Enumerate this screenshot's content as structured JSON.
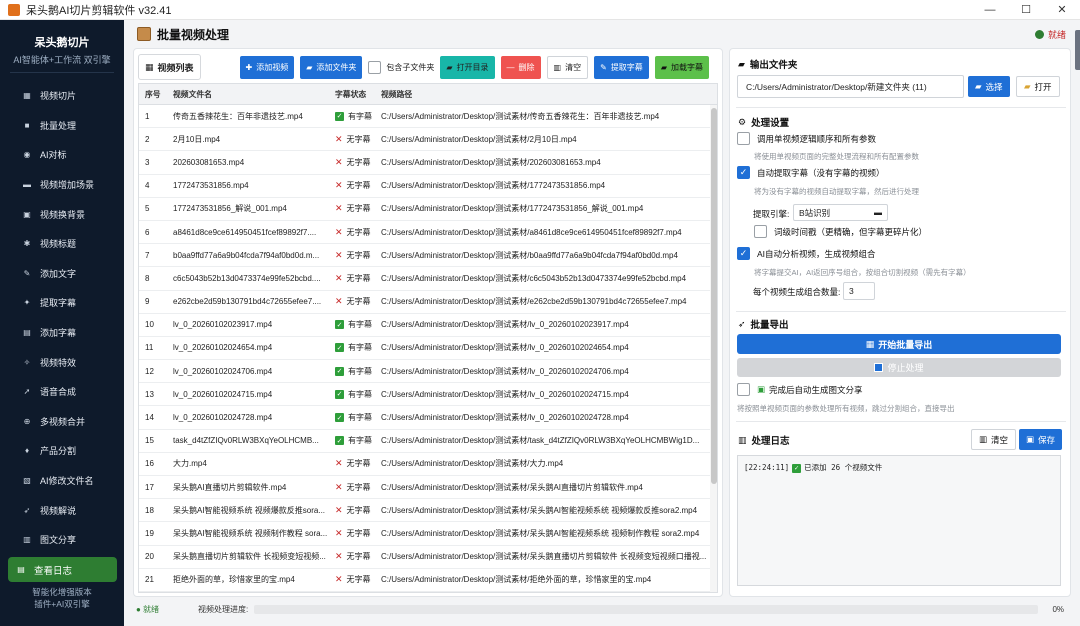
{
  "window": {
    "title": "呆头鹅AI切片剪辑软件 v32.41",
    "minimize": "—",
    "maximize": "☐",
    "close": "✕"
  },
  "sidebar": {
    "brand_name": "呆头鹅切片",
    "brand_sub": "AI智能体+工作流 双引擎",
    "items": [
      {
        "icon": "clip-icon",
        "glyph": "▦",
        "label": "视频切片"
      },
      {
        "icon": "batch-icon",
        "glyph": "■",
        "label": "批量处理"
      },
      {
        "icon": "ai-icon",
        "glyph": "◉",
        "label": "AI对标"
      },
      {
        "icon": "scene-icon",
        "glyph": "▬",
        "label": "视频增加场景"
      },
      {
        "icon": "background-icon",
        "glyph": "▣",
        "label": "视频换背景"
      },
      {
        "icon": "title-icon",
        "glyph": "✱",
        "label": "视频标题"
      },
      {
        "icon": "text-icon",
        "glyph": "✎",
        "label": "添加文字"
      },
      {
        "icon": "extract-icon",
        "glyph": "✦",
        "label": "提取字幕"
      },
      {
        "icon": "subtitle-icon",
        "glyph": "▤",
        "label": "添加字幕"
      },
      {
        "icon": "effects-icon",
        "glyph": "✧",
        "label": "视频特效"
      },
      {
        "icon": "voice-icon",
        "glyph": "➚",
        "label": "语音合成"
      },
      {
        "icon": "merge-icon",
        "glyph": "⊕",
        "label": "多视频合并"
      },
      {
        "icon": "product-icon",
        "glyph": "♦",
        "label": "产品分割"
      },
      {
        "icon": "rename-icon",
        "glyph": "▧",
        "label": "AI修改文件名"
      },
      {
        "icon": "analyze-icon",
        "glyph": "➶",
        "label": "视频解说"
      },
      {
        "icon": "share-icon",
        "glyph": "▥",
        "label": "图文分享"
      }
    ],
    "log_button": "查看日志",
    "footer_line1": "智能化增强版本",
    "footer_line2": "插件+AI双引擎"
  },
  "header": {
    "title": "批量视频处理",
    "status": "就绪"
  },
  "toolbar": {
    "video_list_tab": "视频列表",
    "add_video": "添加视频",
    "add_folder": "添加文件夹",
    "include_subfolders": "包含子文件夹",
    "open_dir": "打开目录",
    "delete": "删除",
    "clear": "清空",
    "extract_subtitles": "提取字幕",
    "add_subtitles": "加载字幕"
  },
  "table": {
    "headers": [
      "序号",
      "视频文件名",
      "字幕状态",
      "视频路径"
    ],
    "rows": [
      {
        "no": "1",
        "name": "传奇五香辣花生：百年非遗技艺.mp4",
        "ok": true,
        "status": "有字幕",
        "path": "C:/Users/Administrator/Desktop/测试素材/传奇五香辣花生：百年非遗技艺.mp4"
      },
      {
        "no": "2",
        "name": "2月10日.mp4",
        "ok": false,
        "status": "无字幕",
        "path": "C:/Users/Administrator/Desktop/测试素材/2月10日.mp4"
      },
      {
        "no": "3",
        "name": "202603081653.mp4",
        "ok": false,
        "status": "无字幕",
        "path": "C:/Users/Administrator/Desktop/测试素材/202603081653.mp4"
      },
      {
        "no": "4",
        "name": "1772473531856.mp4",
        "ok": false,
        "status": "无字幕",
        "path": "C:/Users/Administrator/Desktop/测试素材/1772473531856.mp4"
      },
      {
        "no": "5",
        "name": "1772473531856_解说_001.mp4",
        "ok": false,
        "status": "无字幕",
        "path": "C:/Users/Administrator/Desktop/测试素材/1772473531856_解说_001.mp4"
      },
      {
        "no": "6",
        "name": "a8461d8ce9ce614950451fcef89892f7....",
        "ok": false,
        "status": "无字幕",
        "path": "C:/Users/Administrator/Desktop/测试素材/a8461d8ce9ce614950451fcef89892f7.mp4"
      },
      {
        "no": "7",
        "name": "b0aa9ffd77a6a9b04fcda7f94af0bd0d.m...",
        "ok": false,
        "status": "无字幕",
        "path": "C:/Users/Administrator/Desktop/测试素材/b0aa9ffd77a6a9b04fcda7f94af0bd0d.mp4"
      },
      {
        "no": "8",
        "name": "c6c5043b52b13d0473374e99fe52bcbd....",
        "ok": false,
        "status": "无字幕",
        "path": "C:/Users/Administrator/Desktop/测试素材/c6c5043b52b13d0473374e99fe52bcbd.mp4"
      },
      {
        "no": "9",
        "name": "e262cbe2d59b130791bd4c72655efee7....",
        "ok": false,
        "status": "无字幕",
        "path": "C:/Users/Administrator/Desktop/测试素材/e262cbe2d59b130791bd4c72655efee7.mp4"
      },
      {
        "no": "10",
        "name": "lv_0_20260102023917.mp4",
        "ok": true,
        "status": "有字幕",
        "path": "C:/Users/Administrator/Desktop/测试素材/lv_0_20260102023917.mp4"
      },
      {
        "no": "11",
        "name": "lv_0_20260102024654.mp4",
        "ok": true,
        "status": "有字幕",
        "path": "C:/Users/Administrator/Desktop/测试素材/lv_0_20260102024654.mp4"
      },
      {
        "no": "12",
        "name": "lv_0_20260102024706.mp4",
        "ok": true,
        "status": "有字幕",
        "path": "C:/Users/Administrator/Desktop/测试素材/lv_0_20260102024706.mp4"
      },
      {
        "no": "13",
        "name": "lv_0_20260102024715.mp4",
        "ok": true,
        "status": "有字幕",
        "path": "C:/Users/Administrator/Desktop/测试素材/lv_0_20260102024715.mp4"
      },
      {
        "no": "14",
        "name": "lv_0_20260102024728.mp4",
        "ok": true,
        "status": "有字幕",
        "path": "C:/Users/Administrator/Desktop/测试素材/lv_0_20260102024728.mp4"
      },
      {
        "no": "15",
        "name": "task_d4tZfZIQv0RLW3BXqYeOLHCMB...",
        "ok": true,
        "status": "有字幕",
        "path": "C:/Users/Administrator/Desktop/测试素材/task_d4tZfZIQv0RLW3BXqYeOLHCMBWig1D..."
      },
      {
        "no": "16",
        "name": "大力.mp4",
        "ok": false,
        "status": "无字幕",
        "path": "C:/Users/Administrator/Desktop/测试素材/大力.mp4"
      },
      {
        "no": "17",
        "name": "呆头鹅AI直播切片剪辑软件.mp4",
        "ok": false,
        "status": "无字幕",
        "path": "C:/Users/Administrator/Desktop/测试素材/呆头鹅AI直播切片剪辑软件.mp4"
      },
      {
        "no": "18",
        "name": "呆头鹅AI智能视频系统 视频爆款反推sora...",
        "ok": false,
        "status": "无字幕",
        "path": "C:/Users/Administrator/Desktop/测试素材/呆头鹅AI智能视频系统 视频爆款反推sora2.mp4"
      },
      {
        "no": "19",
        "name": "呆头鹅AI智能视频系统 视频制作教程 sora...",
        "ok": false,
        "status": "无字幕",
        "path": "C:/Users/Administrator/Desktop/测试素材/呆头鹅AI智能视频系统 视频制作教程 sora2.mp4"
      },
      {
        "no": "20",
        "name": "呆头鹅直播切片剪辑软件 长视频变短视频...",
        "ok": false,
        "status": "无字幕",
        "path": "C:/Users/Administrator/Desktop/测试素材/呆头鹅直播切片剪辑软件 长视频变短视频口播视..."
      },
      {
        "no": "21",
        "name": "拒绝外面的草，珍惜家里的宝.mp4",
        "ok": false,
        "status": "无字幕",
        "path": "C:/Users/Administrator/Desktop/测试素材/拒绝外面的草，珍惜家里的宝.mp4"
      }
    ]
  },
  "output": {
    "title": "输出文件夹",
    "path": "C:/Users/Administrator/Desktop/新建文件夹 (11)",
    "select_button": "选择",
    "open_button": "打开"
  },
  "settings": {
    "title": "处理设置",
    "opt1_label": "调用单视频逻辑顺序和所有参数",
    "opt1_hint": "将使用单视频页面的完整处理流程和所有配置参数",
    "opt2_label": "自动提取字幕（没有字幕的视频）",
    "opt2_hint": "将为没有字幕的视频自动提取字幕，然后进行处理",
    "engine_label": "提取引擎:",
    "engine_value": "B站识别",
    "wordlevel_label": "词级时间戳（更精确，但字幕更碎片化）",
    "opt3_label": "AI自动分析视频，生成视频组合",
    "opt3_hint": "将字幕提交AI，AI返回序号组合，按组合切割视频（需先有字幕）",
    "count_label": "每个视频生成组合数量:",
    "count_value": "3"
  },
  "export": {
    "title": "批量导出",
    "start_button": "开始批量导出",
    "stop_button": "停止处理",
    "share_label": "完成后自动生成图文分享",
    "hint": "将按照单视频页面的参数处理所有视频，跳过分割组合，直接导出"
  },
  "log": {
    "title": "处理日志",
    "clear_button": "清空",
    "save_button": "保存",
    "entry_time": "[22:24:11]",
    "entry_text": "已添加 26 个视频文件"
  },
  "statusbar": {
    "ready": "● 就绪",
    "progress_label": "视频处理进度:",
    "progress_value": "0%",
    "progress_fraction": 0
  },
  "colors": {
    "accent": "#1f6fd6",
    "sidebar": "#0e1a2b",
    "ok": "#2e9e3a",
    "error": "#c62828"
  }
}
